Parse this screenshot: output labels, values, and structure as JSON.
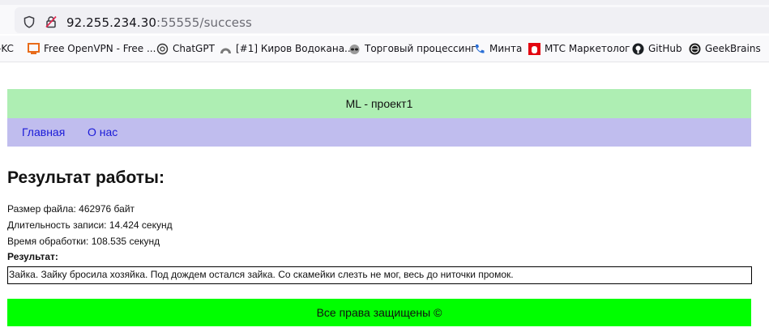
{
  "browser": {
    "url_host": "92.255.234.30",
    "url_rest": ":55555/success",
    "bookmarks": [
      {
        "label": "-KC",
        "icon": "bookmark-icon"
      },
      {
        "label": "Free OpenVPN - Free ...",
        "icon": "openvpn-icon"
      },
      {
        "label": "ChatGPT",
        "icon": "chatgpt-icon"
      },
      {
        "label": "[#1] Киров Водокана...",
        "icon": "redmine-icon"
      },
      {
        "label": "Торговый процессинг",
        "icon": "raccoon-icon"
      },
      {
        "label": "Минта",
        "icon": "phone-icon"
      },
      {
        "label": "МТС Маркетолог",
        "icon": "mts-icon"
      },
      {
        "label": "GitHub",
        "icon": "github-icon"
      },
      {
        "label": "GeekBrains",
        "icon": "geekbrains-icon"
      }
    ]
  },
  "header": {
    "title": "ML - проект1"
  },
  "nav": {
    "items": [
      {
        "label": "Главная"
      },
      {
        "label": "О нас"
      }
    ]
  },
  "main": {
    "heading": "Результат работы:",
    "file_size": "Размер файла: 462976 байт",
    "duration": "Длительность записи: 14.424 секунд",
    "processing_time": "Время обработки: 108.535 секунд",
    "result_label": "Результат:",
    "result_text": "Зайка. Зайку бросила хозяйка. Под дождем остался зайка. Со скамейки слезть не мог, весь до ниточки промок."
  },
  "footer": {
    "text": "Все права защищены ©"
  },
  "colors": {
    "header_bg": "#aeeeb3",
    "nav_bg": "#c0bdee",
    "footer_bg": "#00ff00",
    "link": "#1a1ad8"
  }
}
